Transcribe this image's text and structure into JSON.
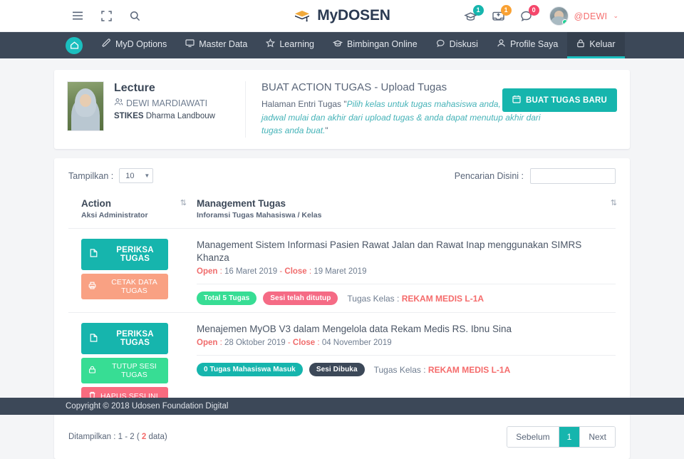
{
  "topbar": {
    "icons": [
      {
        "name": "hamburger-menu-icon",
        "label": "Menu"
      },
      {
        "name": "fullscreen-icon",
        "label": "Fullscreen"
      },
      {
        "name": "search-icon",
        "label": "Search"
      }
    ],
    "brand": {
      "text": "MyDOSEN",
      "icon": "graduation-cap-icon"
    },
    "notifications": [
      {
        "name": "graduation-notification-icon",
        "count": "1",
        "color": "#16b5ad"
      },
      {
        "name": "inbox-notification-icon",
        "count": "1",
        "color": "#f9a133"
      },
      {
        "name": "chat-notification-icon",
        "count": "0",
        "color": "#f5476b"
      }
    ],
    "user": {
      "name": "@DEWI",
      "caret": "⌄"
    }
  },
  "navbar": {
    "home_label": "Home",
    "items": [
      {
        "label": "MyD Options",
        "icon": "pen-icon",
        "active": false
      },
      {
        "label": "Master Data",
        "icon": "monitor-icon",
        "active": false
      },
      {
        "label": "Learning",
        "icon": "star-icon",
        "active": false
      },
      {
        "label": "Bimbingan Online",
        "icon": "cap-icon",
        "active": false
      },
      {
        "label": "Diskusi",
        "icon": "chat-icon",
        "active": false
      },
      {
        "label": "Profile Saya",
        "icon": "user-icon",
        "active": false
      },
      {
        "label": "Keluar",
        "icon": "lock-icon",
        "active": true
      }
    ]
  },
  "hero": {
    "role": "Lecture",
    "person": "DEWI MARDIAWATI",
    "org_bold": "STIKES",
    "org_rest": " Dharma Landbouw",
    "title": "BUAT ACTION TUGAS - Upload Tugas",
    "desc_prefix": "Halaman Entri Tugas \"",
    "desc_italic": "Pilih kelas untuk tugas mahasiswa anda, tentukan jadwal mulai dan akhir dari upload tugas & anda dapat menutup akhir dari tugas anda buat.",
    "desc_suffix": "\"",
    "new_button": "BUAT TUGAS BARU",
    "new_button_icon": "calendar-icon"
  },
  "controls": {
    "show_label": "Tampilkan :",
    "show_value": "10",
    "search_label": "Pencarian Disini :",
    "search_value": "",
    "search_placeholder": ""
  },
  "table": {
    "headers": [
      {
        "title": "Action",
        "sub": "Aksi Administrator",
        "sort": "⇅"
      },
      {
        "title": "Management Tugas",
        "sub": "Inforamsi Tugas Mahasiswa / Kelas",
        "sort": "⇅"
      }
    ],
    "rows": [
      {
        "buttons": [
          {
            "label": "PERIKSA TUGAS",
            "style": "primary",
            "icon": "document-icon"
          },
          {
            "label": "CETAK DATA TUGAS",
            "style": "orange",
            "icon": "printer-icon"
          }
        ],
        "title": "Management Sistem Informasi Pasien Rawat Jalan dan Rawat Inap menggunakan SIMRS Khanza",
        "open_label": "Open",
        "open_date": "16 Maret 2019",
        "close_label": "Close",
        "close_date": "19 Maret 2019",
        "pills": [
          {
            "text": "Total 5 Tugas",
            "style": "green"
          },
          {
            "text": "Sesi telah ditutup",
            "style": "pink"
          }
        ],
        "class_label": "Tugas Kelas :",
        "class_value": "REKAM MEDIS L-1A"
      },
      {
        "buttons": [
          {
            "label": "PERIKSA TUGAS",
            "style": "primary",
            "icon": "document-icon"
          },
          {
            "label": "TUTUP SESI TUGAS",
            "style": "green",
            "icon": "lock-close-icon"
          },
          {
            "label": "HAPUS SESI INI",
            "style": "red",
            "icon": "trash-icon"
          }
        ],
        "title": "Menajemen MyOB V3 dalam Mengelola data Rekam Medis RS. Ibnu Sina",
        "open_label": "Open",
        "open_date": "28 Oktober 2019",
        "close_label": "Close",
        "close_date": "04 November 2019",
        "pills": [
          {
            "text": "0 Tugas Mahasiswa Masuk",
            "style": "teal"
          },
          {
            "text": "Sesi Dibuka",
            "style": "dark"
          }
        ],
        "class_label": "Tugas Kelas :",
        "class_value": "REKAM MEDIS L-1A"
      }
    ],
    "footer_info_prefix": "Ditampilkan : 1 - 2 ( ",
    "footer_info_count": "2",
    "footer_info_suffix": " data)",
    "pager": {
      "prev": "Sebelum",
      "current": "1",
      "next": "Next"
    }
  },
  "footer": {
    "copyright": "Copyright © 2018 Udosen Foundation Digital"
  }
}
